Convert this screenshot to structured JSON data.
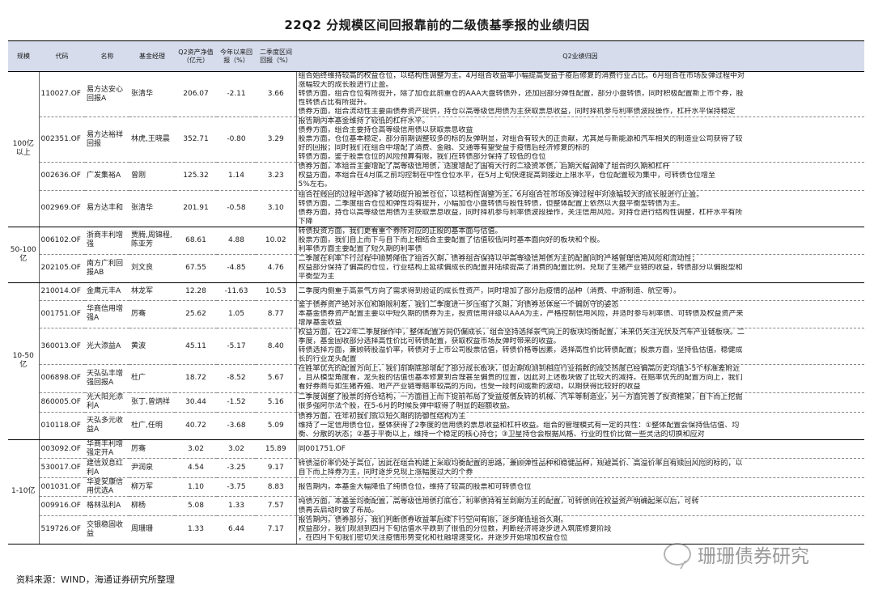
{
  "title": "22Q2 分规模区间回报靠前的二级债基季报的业绩归因",
  "headers": {
    "scale": "规模",
    "code": "代码",
    "name": "名称",
    "manager": "基金经理",
    "nav": "Q2资产净值（亿元）",
    "ytd": "今年以来回报（%）",
    "q2": "二季度区间回报（%）",
    "attr": "Q2业绩归因"
  },
  "groups": [
    {
      "scale": "100亿以上",
      "funds": [
        {
          "code": "110027.OF",
          "name": "易方达安心回报A",
          "manager": "张清华",
          "nav": "206.07",
          "ytd": "-2.11",
          "q2": "3.66",
          "lines": [
            "组合始终维持较高的权益仓位，以结构性调整为主。4月组合收益率小幅提高受益于疫后修复的消费行业占比。6月组合在市场反弹过程中对",
            "涨幅较大的成长股进行止盈。",
            "转债方面，组合仓位有所提升，除了加仓此前重仓的AAA大盘转债外，还加回部分弹性配置，部分小盘转债，同时积极配置新上市个券，股",
            "性转债占比有所提升。",
            "债券方面，组合流动性主要由债券资产提供，持仓以高等级信用债为主获取票息收益，同时择机参与利率债波段操作，杠杆水平保持稳定"
          ]
        },
        {
          "code": "002351.OF",
          "name": "易方达裕祥回报",
          "manager": "林虎,王晓晨",
          "nav": "352.71",
          "ytd": "-0.80",
          "q2": "3.29",
          "lines": [
            "报告期内本基金维持了较低的杠杆水平。",
            "债券方面，组合主要持仓高等级信用债以获取票息收益",
            "股票方面，仓位基本稳定，部分前期调整较多的标的反弹明显，对组合有较大的正贡献，尤其是与新能源和汽车相关的制造业公司获得了较",
            "好的回报；同时我们在组合中增配了消费、金融、交通等有望受益于疫情后经济修复的标的",
            "转债方面，鉴于股票仓位的风险预算有限，我们在转债部分保持了较低的仓位"
          ]
        },
        {
          "code": "002636.OF",
          "name": "广发集裕A",
          "manager": "曾刚",
          "nav": "125.32",
          "ytd": "1.14",
          "q2": "3.23",
          "lines": [
            "债券方面，本组合主要增配了高等级信用债，适度增配了国有大行的二级资本债，后期大幅调降了组合的久期和杠杆",
            "权益方面，本组合在4月底之前均控制在中性仓位水平，在5月上旬快速提高到接近上限水平，仓位配置较为集中，可转债仓位增至",
            "5%左右。"
          ]
        },
        {
          "code": "002969.OF",
          "name": "易方达丰和",
          "manager": "张清华",
          "nav": "201.91",
          "ytd": "-0.58",
          "q2": "3.10",
          "lines": [
            "组合在贱回的过程中选择了被动提升股票仓位，以结构性调整为主。6月组合在市场反弹过程中对涨幅较大的成长股进行止盈。",
            "转债方面，二季度组合仓位和弹性均有提升，小幅加仓小盘转债与股性转债，但整体配置上依然以大盘平衡型转债为主。",
            "债券方面，持仓以高等级信用债为主获取票息收益，同时择机参与利率债波段操作，关注信用风险。对持仓进行结构性调整，杠杆水平有所",
            "下降"
          ]
        }
      ]
    },
    {
      "scale": "50-100亿",
      "funds": [
        {
          "code": "006102.OF",
          "name": "浙商丰利增强",
          "manager": "贾腾,周锦程,陈亚芳",
          "nav": "68.61",
          "ytd": "4.88",
          "q2": "10.02",
          "lines": [
            "转债投资方面，我们更看重个券所对应的正股的基本面与估值。",
            "股票方面，我们自上而下与自下而上相结合主要配置了估值较低同时基本面向好的板块和个股。",
            "利率债方面主要配置了短久期的利率债"
          ]
        },
        {
          "code": "202105.OF",
          "name": "南方广利回报AB",
          "manager": "刘文良",
          "nav": "67.55",
          "ytd": "-4.85",
          "q2": "4.76",
          "lines": [
            "二季度在利率下行过程中顺势降低了组合久期，债券组合保持以中高等级信用债为主的配置同时严格管理信用风险和流动性；",
            "权益部分保持了偏高的仓位，行业结构上延续偏成长的配置并陆续提高了消费的配置比例，兑现了生猪产业链的收益，转债部分以偏股型和",
            "平衡型为主"
          ]
        }
      ]
    },
    {
      "scale": "10-50亿",
      "funds": [
        {
          "code": "210014.OF",
          "name": "金鹰元丰A",
          "manager": "林龙军",
          "nav": "12.28",
          "ytd": "-11.63",
          "q2": "10.53",
          "lines": [
            "二季度内侧重于高景气方向了需求得到验证的成长性资产，同时增加了部分后疫情的品种（消费、中游制造、航空等）。"
          ]
        },
        {
          "code": "001751.OF",
          "name": "华商信用增强A",
          "manager": "厉骞",
          "nav": "25.62",
          "ytd": "1.05",
          "q2": "8.77",
          "lines": [
            "鉴于债券资产绝对水位和期限利差，我们二季度进一步压缩了久期，对债券总体是一个偏防守的姿态",
            "本基金债券资产配置主要以中短久期的债券为主，投资信用评级以AAA为主，严格控制信用风险，并适时参与利率债、可转债及权益资产来",
            "增厚基金收益"
          ]
        },
        {
          "code": "360013.OF",
          "name": "光大添益A",
          "manager": "黄波",
          "nav": "45.11",
          "ytd": "-5.17",
          "q2": "8.40",
          "lines": [
            "权益方面，在22年二季度操作中，整体配置方向仍偏成长，组合坚持选择景气向上的板块均衡配置，未来仍关注光伏及汽车产业链板块。二",
            "季度，基金固收部分选择高性价比可转债配置，获取权益市场反弹时带来的收益。",
            "转债选择方面，兼顾转股溢价率，转债对于上市公司股票估值，转债价格等因素，选择高性价比转债配置；股票方面，坚持低估值，稳健成",
            "长的行业龙头配置"
          ]
        },
        {
          "code": "006898.OF",
          "name": "天弘弘丰增强回报A",
          "manager": "杜广",
          "nav": "18.72",
          "ytd": "-8.52",
          "q2": "5.67",
          "lines": [
            "在胜率优先的配置方向上，我们前期底部增配了部分成长板块，但近期观测到相应行业指数的成交热度已经偏高历史均值3-5个标准差附近",
            "，且从模型角度看，龙头股的估值也基本修复到合理甚至偏贵的位置，因此对上述板块做了比较大的减持。在赔率优先的配置方向上，我们",
            "看好券商与如生猪养殖、地产产业链等赔率较高的方向，也受一段时间或新的波动，以期获得比较好的收益"
          ]
        },
        {
          "code": "860005.OF",
          "name": "光大阳光添利A",
          "manager": "张丁,曾炳祥",
          "nav": "30.44",
          "ytd": "-1.52",
          "q2": "5.16",
          "lines": [
            "二季度调整了股票的持仓结构，一方面自上而下提前布局了受益疫情反转的机械、汽车等制造业，另一方面完善了投资框架，自下而上挖掘",
            "很多强阿尔法个股，在5-6月的时候反弹中取得了明显的超额收益。"
          ]
        },
        {
          "code": "010118.OF",
          "name": "天弘多元收益A",
          "manager": "杜广,任明",
          "nav": "40.72",
          "ytd": "-3.68",
          "q2": "5.09",
          "lines": [
            "债券方面，在年初我们就以短久期的防御性结构为主",
            "维持了一定信用债仓位，整体获得了2季度的信用债的票息收益和杠杆收益。组合的管理模式有一定的共性：①整体配置会保持低估值、均",
            "衡、分散的状态；②基于平衡以上，维持一个稳定的核心持仓；③卫星持仓会根据风格、行业的性价比做一些灵活的切换和应对"
          ]
        }
      ]
    },
    {
      "scale": "1-10亿",
      "funds": [
        {
          "code": "003092.OF",
          "name": "华商丰利增强定开A",
          "manager": "厉骞",
          "nav": "3.02",
          "ytd": "3.02",
          "q2": "15.89",
          "lines": [
            "同001751.OF"
          ]
        },
        {
          "code": "530017.OF",
          "name": "建信双息红利A",
          "manager": "尹润泉",
          "nav": "4.54",
          "ytd": "-3.25",
          "q2": "9.17",
          "lines": [
            "转债溢价率仍处于高位，因此在组合构建上采取均衡配置的思路，兼顾弹性品种和稳健品种，规避高价、高溢价率且有赎回风险的标的，以",
            "自下而上择券为主，同时逐步兑现上涨幅度过大的个券"
          ]
        },
        {
          "code": "001031.OF",
          "name": "华夏安康信用优选A",
          "manager": "柳万军",
          "nav": "1.10",
          "ytd": "-3.75",
          "q2": "8.83",
          "lines": [
            "报告期内，本基金大幅降低了纯债仓位，维持了较高的股票和可转债仓位"
          ]
        },
        {
          "code": "009916.OF",
          "name": "格林泓利A",
          "manager": "柳杨",
          "nav": "5.08",
          "ytd": "1.33",
          "q2": "7.57",
          "lines": [
            "纯债方面，本基金均衡配置，高等级信用债打底仓，利率债持有至到期为主的配置，可转债则在权益资产明确起来以后，可转",
            "债再去启动时做了布局。"
          ]
        },
        {
          "code": "519726.OF",
          "name": "交银稳固收益",
          "manager": "周珊珊",
          "nav": "1.33",
          "ytd": "6.44",
          "q2": "7.17",
          "lines": [
            "报告期内，债券部分，我们判断债券收益率后续下行空间有限，逐步降低组合久期。",
            "权益部分，我们观测到四月下旬估值水平跌到了很低的分位数，判断经济将逐步进入筑底修复阶段",
            "，在四月下旬我们密切关注疫情形势变化和社融增速变化，并逐步开始增加权益仓位"
          ]
        }
      ]
    }
  ],
  "source": "资料来源：WIND，海通证券研究所整理",
  "watermark": "珊珊债券研究"
}
